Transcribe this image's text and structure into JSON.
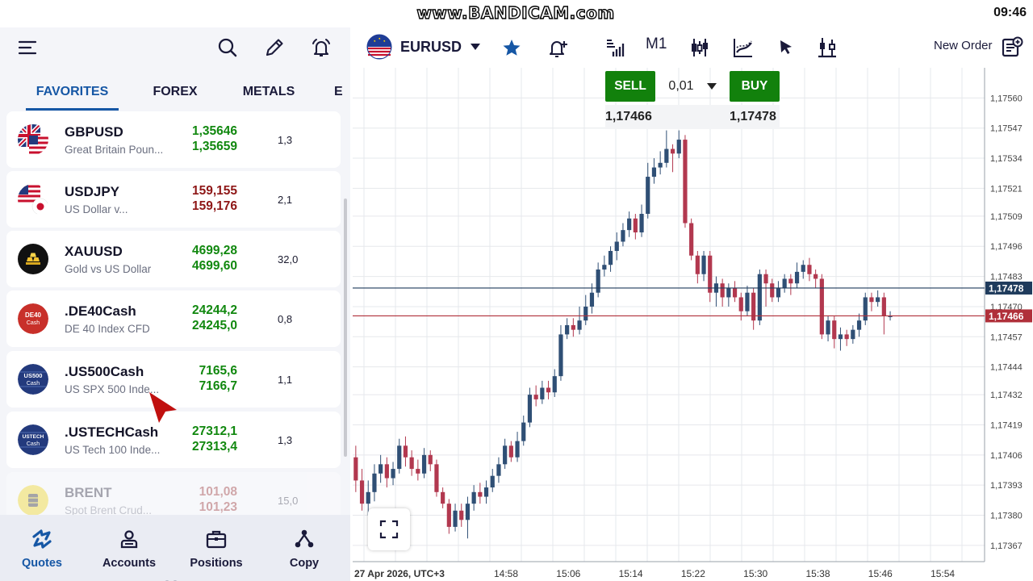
{
  "status_bar": {
    "watermark": "www.BANDICAM.com",
    "time": "09:46"
  },
  "left_toolbar": {
    "icons": [
      "menu-icon",
      "search-icon",
      "edit-icon",
      "alarm-icon"
    ]
  },
  "tabs": [
    {
      "label": "FAVORITES",
      "active": true
    },
    {
      "label": "FOREX",
      "active": false
    },
    {
      "label": "METALS",
      "active": false
    },
    {
      "label": "E",
      "active": false
    }
  ],
  "quotes": [
    {
      "symbol": "GBPUSD",
      "description": "Great Britain Poun...",
      "bid": "1,35646",
      "ask": "1,35659",
      "spread": "1,3",
      "bid_color": "#11880f",
      "ask_color": "#11880f"
    },
    {
      "symbol": "USDJPY",
      "description": "US Dollar v...",
      "bid": "159,155",
      "ask": "159,176",
      "spread": "2,1",
      "bid_color": "#8e1616",
      "ask_color": "#8e1616"
    },
    {
      "symbol": "XAUUSD",
      "description": "Gold vs US Dollar",
      "bid": "4699,28",
      "ask": "4699,60",
      "spread": "32,0",
      "bid_color": "#11880f",
      "ask_color": "#11880f"
    },
    {
      "symbol": ".DE40Cash",
      "description": "DE 40 Index CFD",
      "bid": "24244,2",
      "ask": "24245,0",
      "spread": "0,8",
      "bid_color": "#11880f",
      "ask_color": "#11880f",
      "badge": "DE40\nCash"
    },
    {
      "symbol": ".US500Cash",
      "description": "US SPX 500 Inde...",
      "bid": "7165,6",
      "ask": "7166,7",
      "spread": "1,1",
      "bid_color": "#11880f",
      "ask_color": "#11880f",
      "badge": "US500\nCash"
    },
    {
      "symbol": ".USTECHCash",
      "description": "US Tech 100 Inde...",
      "bid": "27312,1",
      "ask": "27313,4",
      "spread": "1,3",
      "bid_color": "#11880f",
      "ask_color": "#11880f",
      "badge": "USTECH\nCash"
    },
    {
      "symbol": "BRENT",
      "description": "Spot Brent Crud...",
      "bid": "101,08",
      "ask": "101,23",
      "spread": "15,0",
      "bid_color": "#8e1616",
      "ask_color": "#8e1616"
    }
  ],
  "badges": {
    "de40": [
      "DE40",
      "Cash"
    ],
    "us500": [
      "US500",
      "Cash"
    ],
    "ustech": [
      "USTECH",
      "Cash"
    ]
  },
  "bottom_nav": [
    {
      "label": "Quotes",
      "icon": "quotes-icon",
      "active": true
    },
    {
      "label": "Accounts",
      "icon": "accounts-icon",
      "active": false
    },
    {
      "label": "Positions",
      "icon": "positions-icon",
      "active": false
    },
    {
      "label": "Copy",
      "icon": "copy-icon",
      "active": false
    }
  ],
  "chart_toolbar": {
    "symbol": "EURUSD",
    "timeframe": "M1",
    "new_order": "New Order",
    "icons": [
      "flag-icon",
      "chevron-down-icon",
      "star-icon",
      "add-alert-icon",
      "depth-icon",
      "candle-type-icon",
      "indicators-icon",
      "cursor-icon",
      "objects-icon",
      "new-order-icon"
    ]
  },
  "trade_panel": {
    "sell_label": "SELL",
    "buy_label": "BUY",
    "lot": "0,01",
    "sell_price": "1,17466",
    "buy_price": "1,17478"
  },
  "colors": {
    "bull": "#2f4f75",
    "bear": "#b2384f",
    "ask_line": "#1f3b5c",
    "bid_line": "#b0303a",
    "accent": "#1657a5",
    "trade_green": "#12810c"
  },
  "chart_data": {
    "type": "candlestick",
    "symbol": "EURUSD",
    "timeframe": "M1",
    "x_labels": [
      "27 Apr 2026, UTC+3",
      "14:58",
      "15:06",
      "15:14",
      "15:22",
      "15:30",
      "15:38",
      "15:46",
      "15:54"
    ],
    "y_ticks": [
      "1,17560",
      "1,17547",
      "1,17534",
      "1,17521",
      "1,17509",
      "1,17496",
      "1,17483",
      "1,17470",
      "1,17457",
      "1,17444",
      "1,17432",
      "1,17419",
      "1,17406",
      "1,17393",
      "1,17380",
      "1,17367"
    ],
    "ylim": [
      1.1736,
      1.17573
    ],
    "grid": true,
    "ask_line": {
      "value": 1.17478,
      "label": "1,17478"
    },
    "bid_line": {
      "value": 1.17466,
      "label": "1,17466"
    },
    "candles": [
      [
        1.17405,
        1.17395,
        1.1741,
        1.1739
      ],
      [
        1.17395,
        1.17385,
        1.174,
        1.17382
      ],
      [
        1.17385,
        1.1739,
        1.17395,
        1.1738
      ],
      [
        1.1739,
        1.17398,
        1.17402,
        1.17386
      ],
      [
        1.17398,
        1.17402,
        1.17406,
        1.17394
      ],
      [
        1.17402,
        1.17396,
        1.17405,
        1.17392
      ],
      [
        1.17396,
        1.174,
        1.17403,
        1.17393
      ],
      [
        1.174,
        1.1741,
        1.17413,
        1.17398
      ],
      [
        1.1741,
        1.17405,
        1.17414,
        1.17401
      ],
      [
        1.17405,
        1.174,
        1.17408,
        1.17397
      ],
      [
        1.174,
        1.17398,
        1.17404,
        1.17395
      ],
      [
        1.17398,
        1.17406,
        1.17409,
        1.17396
      ],
      [
        1.17406,
        1.17402,
        1.17408,
        1.17399
      ],
      [
        1.17402,
        1.1739,
        1.17404,
        1.17388
      ],
      [
        1.1739,
        1.17385,
        1.17392,
        1.17383
      ],
      [
        1.17385,
        1.17375,
        1.17387,
        1.17372
      ],
      [
        1.17375,
        1.17382,
        1.17385,
        1.17373
      ],
      [
        1.17382,
        1.17378,
        1.17385,
        1.17375
      ],
      [
        1.17378,
        1.17385,
        1.17388,
        1.1737
      ],
      [
        1.17385,
        1.1739,
        1.17393,
        1.17382
      ],
      [
        1.1739,
        1.17388,
        1.17394,
        1.17385
      ],
      [
        1.17388,
        1.17392,
        1.17395,
        1.17385
      ],
      [
        1.17392,
        1.17397,
        1.174,
        1.1739
      ],
      [
        1.17397,
        1.17402,
        1.17405,
        1.17394
      ],
      [
        1.17402,
        1.1741,
        1.17413,
        1.174
      ],
      [
        1.1741,
        1.17405,
        1.17412,
        1.17403
      ],
      [
        1.17405,
        1.17412,
        1.17416,
        1.17403
      ],
      [
        1.17412,
        1.1742,
        1.17423,
        1.1741
      ],
      [
        1.1742,
        1.17432,
        1.17435,
        1.17418
      ],
      [
        1.17432,
        1.1743,
        1.17436,
        1.17427
      ],
      [
        1.1743,
        1.17435,
        1.17438,
        1.17428
      ],
      [
        1.17435,
        1.17433,
        1.17438,
        1.1743
      ],
      [
        1.17433,
        1.1744,
        1.17443,
        1.17431
      ],
      [
        1.1744,
        1.17458,
        1.17462,
        1.17438
      ],
      [
        1.17458,
        1.17462,
        1.17465,
        1.17456
      ],
      [
        1.17462,
        1.1746,
        1.17465,
        1.17457
      ],
      [
        1.1746,
        1.17464,
        1.1747,
        1.17458
      ],
      [
        1.17464,
        1.1747,
        1.17475,
        1.17462
      ],
      [
        1.1747,
        1.17476,
        1.1748,
        1.17467
      ],
      [
        1.17476,
        1.17486,
        1.17489,
        1.17474
      ],
      [
        1.17486,
        1.17488,
        1.17492,
        1.17483
      ],
      [
        1.17488,
        1.17494,
        1.17496,
        1.17485
      ],
      [
        1.17494,
        1.17498,
        1.17502,
        1.1749
      ],
      [
        1.17498,
        1.17503,
        1.17506,
        1.17496
      ],
      [
        1.17503,
        1.17508,
        1.17511,
        1.175
      ],
      [
        1.17508,
        1.17502,
        1.1751,
        1.17499
      ],
      [
        1.17502,
        1.1751,
        1.17514,
        1.175
      ],
      [
        1.1751,
        1.17526,
        1.17532,
        1.17508
      ],
      [
        1.17526,
        1.1753,
        1.17534,
        1.17523
      ],
      [
        1.1753,
        1.17532,
        1.17537,
        1.17527
      ],
      [
        1.17532,
        1.17538,
        1.17546,
        1.1753
      ],
      [
        1.17538,
        1.17536,
        1.1754,
        1.17528
      ],
      [
        1.17536,
        1.17542,
        1.17546,
        1.17534
      ],
      [
        1.17542,
        1.17506,
        1.17544,
        1.17504
      ],
      [
        1.17506,
        1.17492,
        1.17508,
        1.1749
      ],
      [
        1.17492,
        1.17484,
        1.17494,
        1.1748
      ],
      [
        1.17484,
        1.17492,
        1.17494,
        1.17481
      ],
      [
        1.17492,
        1.17476,
        1.17494,
        1.17472
      ],
      [
        1.17476,
        1.1748,
        1.17483,
        1.1747
      ],
      [
        1.1748,
        1.17474,
        1.17482,
        1.1747
      ],
      [
        1.17474,
        1.17478,
        1.1748,
        1.1747
      ],
      [
        1.17478,
        1.17474,
        1.17481,
        1.17472
      ],
      [
        1.17474,
        1.17468,
        1.17476,
        1.17464
      ],
      [
        1.17468,
        1.17476,
        1.17479,
        1.17466
      ],
      [
        1.17476,
        1.17464,
        1.17478,
        1.1746
      ],
      [
        1.17464,
        1.17484,
        1.17486,
        1.17462
      ],
      [
        1.17484,
        1.1748,
        1.17486,
        1.1747
      ],
      [
        1.1748,
        1.17474,
        1.17482,
        1.17472
      ],
      [
        1.17474,
        1.17478,
        1.17481,
        1.17472
      ],
      [
        1.17478,
        1.17482,
        1.17484,
        1.17476
      ],
      [
        1.17482,
        1.1748,
        1.17484,
        1.17475
      ],
      [
        1.1748,
        1.17485,
        1.17489,
        1.17478
      ],
      [
        1.17485,
        1.17488,
        1.1749,
        1.17482
      ],
      [
        1.17488,
        1.17484,
        1.17491,
        1.17481
      ],
      [
        1.17484,
        1.17482,
        1.17486,
        1.17478
      ],
      [
        1.17482,
        1.17458,
        1.17484,
        1.17456
      ],
      [
        1.17458,
        1.17464,
        1.17466,
        1.17455
      ],
      [
        1.17464,
        1.17456,
        1.17466,
        1.17452
      ],
      [
        1.17456,
        1.17458,
        1.17461,
        1.17451
      ],
      [
        1.17458,
        1.17456,
        1.1746,
        1.17453
      ],
      [
        1.17456,
        1.1746,
        1.17462,
        1.17454
      ],
      [
        1.1746,
        1.17464,
        1.17467,
        1.17457
      ],
      [
        1.17464,
        1.17474,
        1.17476,
        1.17462
      ],
      [
        1.17474,
        1.17472,
        1.17476,
        1.17468
      ],
      [
        1.17472,
        1.17474,
        1.17477,
        1.1747
      ],
      [
        1.17474,
        1.17466,
        1.17476,
        1.17458
      ],
      [
        1.17466,
        1.17466,
        1.17468,
        1.17464
      ]
    ]
  }
}
